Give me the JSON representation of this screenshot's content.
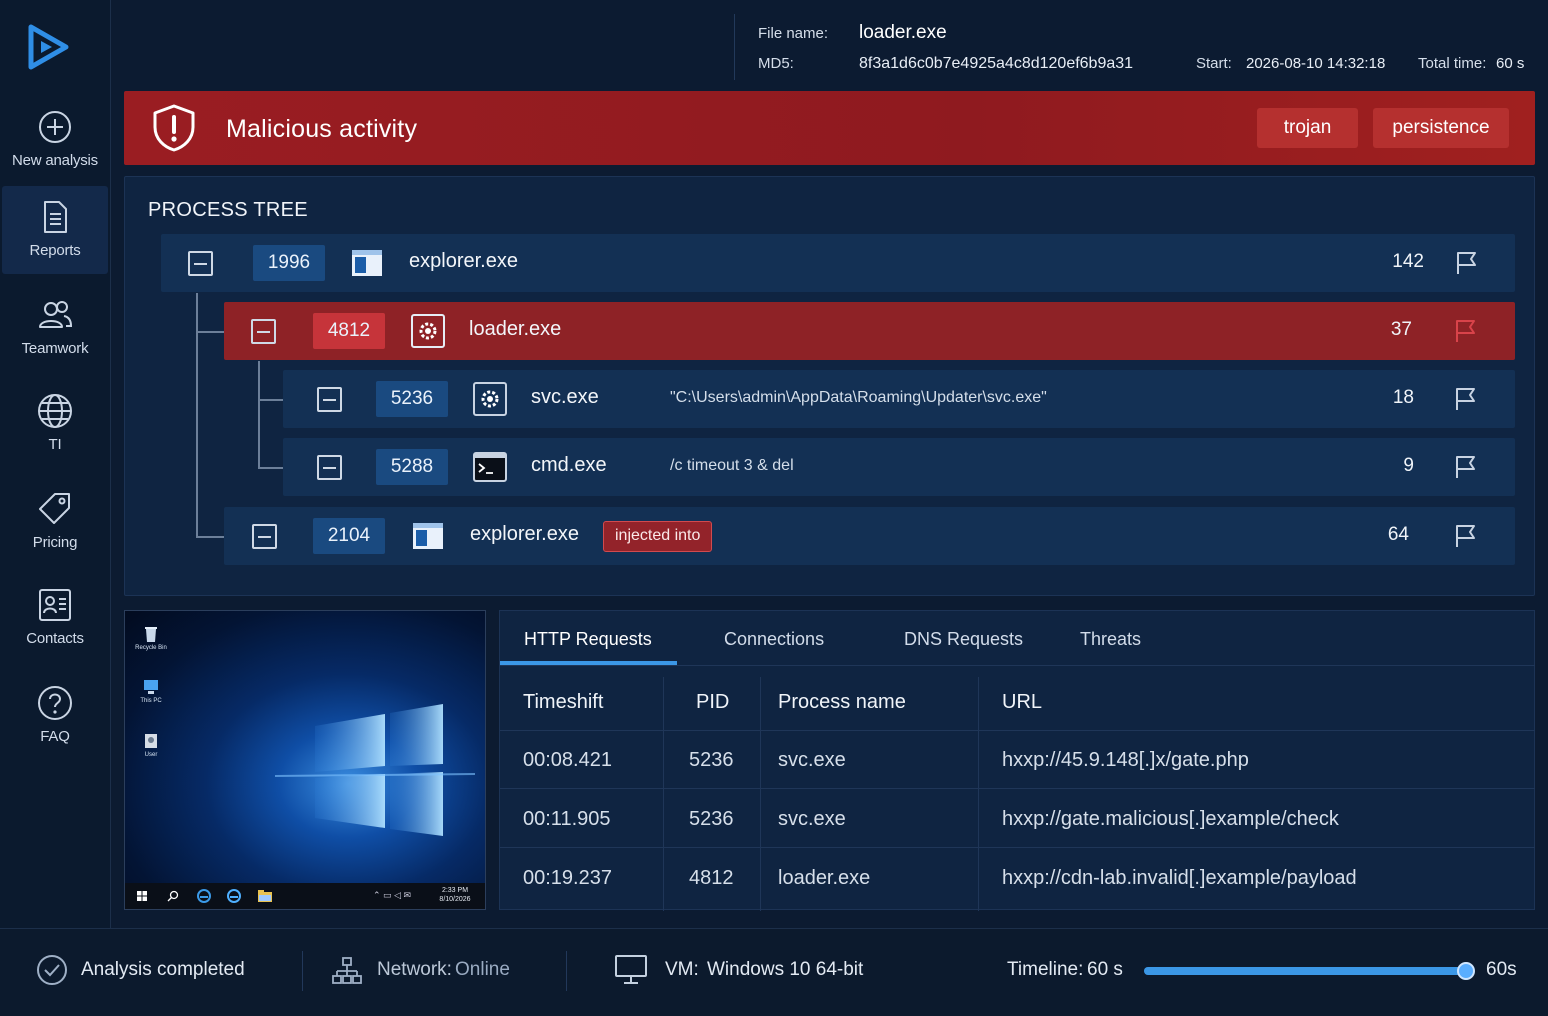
{
  "sidebar": {
    "items": [
      {
        "label": "New analysis",
        "icon": "plus-circle-icon"
      },
      {
        "label": "Reports",
        "icon": "document-icon",
        "active": true
      },
      {
        "label": "Teamwork",
        "icon": "users-icon"
      },
      {
        "label": "TI",
        "icon": "globe-icon"
      },
      {
        "label": "Pricing",
        "icon": "tag-icon"
      },
      {
        "label": "Contacts",
        "icon": "contact-card-icon"
      },
      {
        "label": "FAQ",
        "icon": "question-circle-icon"
      }
    ]
  },
  "header": {
    "file_name_label": "File name:",
    "file_name": "loader.exe",
    "md5_label": "MD5:",
    "md5": "8f3a1d6c0b7e4925a4c8d120ef6b9a31",
    "start_label": "Start:",
    "start": "2026-08-10 14:32:18",
    "total_time_label": "Total time:",
    "total_time": "60 s"
  },
  "alert": {
    "title": "Malicious activity",
    "tags": [
      "trojan",
      "persistence"
    ],
    "color": "#9a1d22"
  },
  "process_tree": {
    "title": "PROCESS TREE",
    "processes": [
      {
        "pid": "1996",
        "name": "explorer.exe",
        "cmd": "",
        "count": "142",
        "icon": "window-icon",
        "malicious": false
      },
      {
        "pid": "4812",
        "name": "loader.exe",
        "cmd": "",
        "count": "37",
        "icon": "gear-icon",
        "malicious": true
      },
      {
        "pid": "5236",
        "name": "svc.exe",
        "cmd": "\"C:\\Users\\admin\\AppData\\Roaming\\Updater\\svc.exe\"",
        "count": "18",
        "icon": "gear-icon",
        "malicious": false
      },
      {
        "pid": "5288",
        "name": "cmd.exe",
        "cmd": "/c timeout 3 & del",
        "count": "9",
        "icon": "terminal-icon",
        "malicious": false
      },
      {
        "pid": "2104",
        "name": "explorer.exe",
        "cmd": "",
        "count": "64",
        "icon": "window-icon",
        "malicious": false,
        "tag": "injected into"
      }
    ]
  },
  "vm_screenshot": {
    "desktop_icons": [
      "Recycle Bin",
      "This PC",
      "User"
    ],
    "clock_time": "2:33 PM",
    "clock_date": "8/10/2026"
  },
  "network": {
    "tabs": [
      "HTTP Requests",
      "Connections",
      "DNS Requests",
      "Threats"
    ],
    "active_tab": "HTTP Requests",
    "columns": [
      "Timeshift",
      "PID",
      "Process name",
      "URL"
    ],
    "rows": [
      {
        "timeshift": "00:08.421",
        "pid": "5236",
        "process": "svc.exe",
        "url": "hxxp://45.9.148[.]x/gate.php"
      },
      {
        "timeshift": "00:11.905",
        "pid": "5236",
        "process": "svc.exe",
        "url": "hxxp://gate.malicious[.]example/check"
      },
      {
        "timeshift": "00:19.237",
        "pid": "4812",
        "process": "loader.exe",
        "url": "hxxp://cdn-lab.invalid[.]example/payload"
      }
    ]
  },
  "statusbar": {
    "analysis_status": "Analysis completed",
    "network_label": "Network:",
    "network_value": "Online",
    "vm_label": "VM:",
    "vm_value": "Windows 10 64-bit",
    "timeline_label": "Timeline:",
    "timeline_value": "60 s",
    "slider_end": "60s",
    "slider_fraction": 1.0
  },
  "colors": {
    "accent": "#3b97e6",
    "danger": "#c6343a",
    "background": "#0c1b31"
  }
}
